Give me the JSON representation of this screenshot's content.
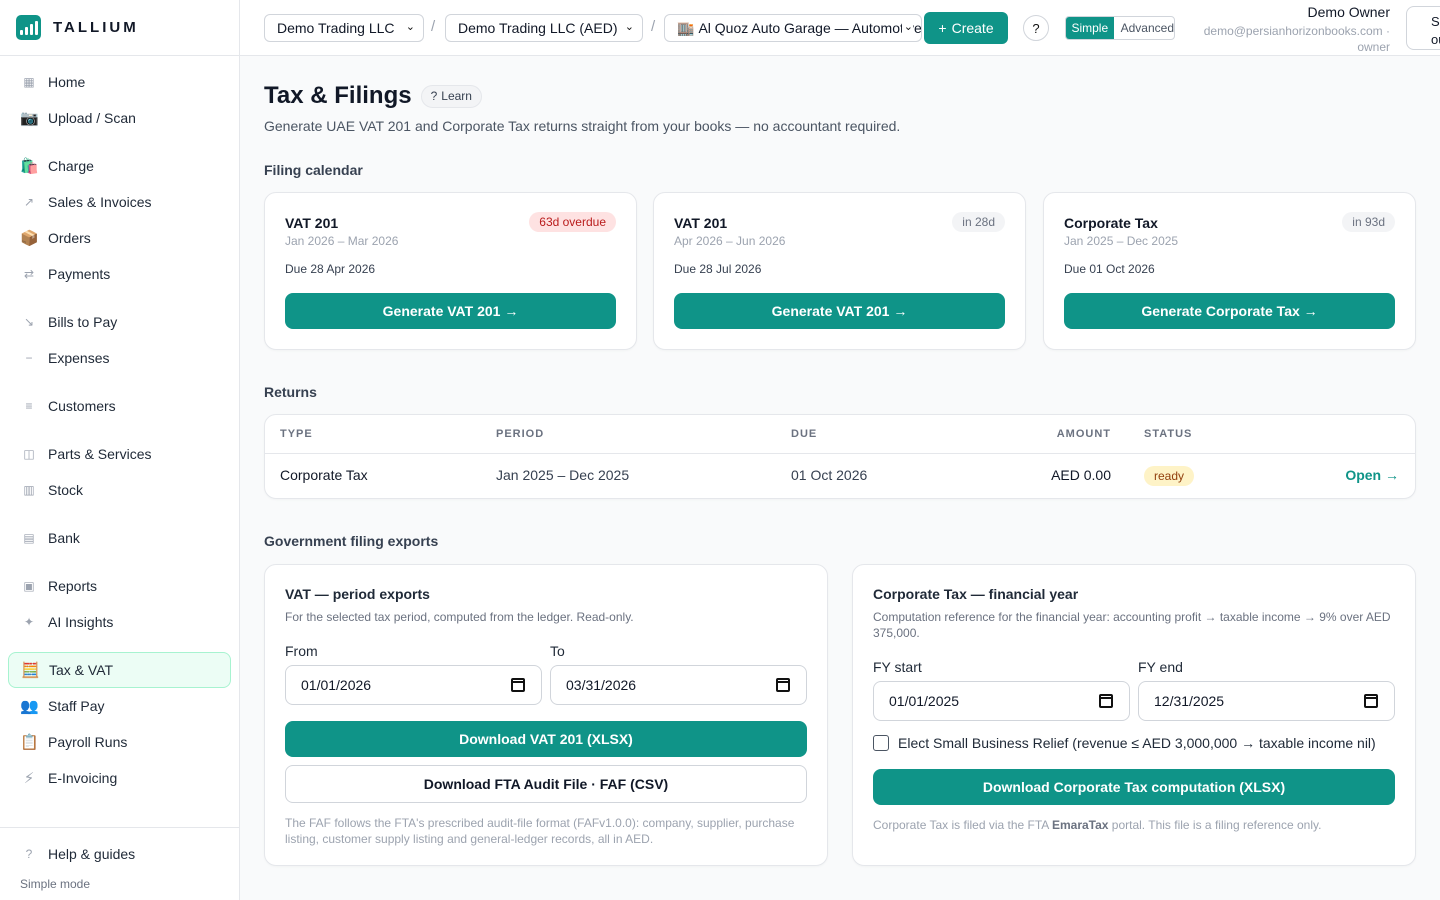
{
  "brand": {
    "name": "TALLIUM"
  },
  "sidebar": {
    "items": [
      {
        "label": "Home",
        "icon": "grid-icon",
        "glyph": "▦"
      },
      {
        "label": "Upload / Scan",
        "icon": "camera-icon",
        "glyph": "📷"
      },
      {
        "label": "Charge",
        "icon": "shopping-bags-icon",
        "glyph": "🛍️"
      },
      {
        "label": "Sales & Invoices",
        "icon": "arrow-up-right-icon",
        "glyph": "↗"
      },
      {
        "label": "Orders",
        "icon": "package-icon",
        "glyph": "📦"
      },
      {
        "label": "Payments",
        "icon": "arrows-swap-icon",
        "glyph": "⇄"
      },
      {
        "label": "Bills to Pay",
        "icon": "arrow-down-right-icon",
        "glyph": "↘"
      },
      {
        "label": "Expenses",
        "icon": "minus-icon",
        "glyph": "−"
      },
      {
        "label": "Customers",
        "icon": "list-icon",
        "glyph": "≡"
      },
      {
        "label": "Parts & Services",
        "icon": "box-icon",
        "glyph": "◫"
      },
      {
        "label": "Stock",
        "icon": "shelves-icon",
        "glyph": "▥"
      },
      {
        "label": "Bank",
        "icon": "bank-icon",
        "glyph": "▤"
      },
      {
        "label": "Reports",
        "icon": "square-icon",
        "glyph": "▣"
      },
      {
        "label": "AI Insights",
        "icon": "sparkle-icon",
        "glyph": "✦"
      },
      {
        "label": "Tax & VAT",
        "icon": "abacus-icon",
        "glyph": "🧮"
      },
      {
        "label": "Staff Pay",
        "icon": "people-icon",
        "glyph": "👥"
      },
      {
        "label": "Payroll Runs",
        "icon": "clipboard-icon",
        "glyph": "📋"
      },
      {
        "label": "E-Invoicing",
        "icon": "lightning-icon",
        "glyph": "⚡"
      }
    ],
    "active": "Tax & VAT",
    "help_label": "Help & guides",
    "mode_note": "Simple mode"
  },
  "topbar": {
    "company": "Demo Trading LLC",
    "ledger": "Demo Trading LLC (AED)",
    "branch": "Al Quoz Auto Garage — Automotive",
    "create_label": "Create",
    "help_label": "?",
    "mode_simple": "Simple",
    "mode_advanced": "Advanced",
    "user_name": "Demo Owner",
    "user_email": "demo@persianhorizonbooks.com ·",
    "user_role": "owner",
    "signout_label": "Sign out"
  },
  "page": {
    "title": "Tax & Filings",
    "learn_label": "Learn",
    "subtitle": "Generate UAE VAT 201 and Corporate Tax returns straight from your books — no accountant required."
  },
  "calendar": {
    "heading": "Filing calendar",
    "cards": [
      {
        "name": "VAT 201",
        "period": "Jan 2026 – Mar 2026",
        "due": "Due 28 Apr 2026",
        "badge": "63d overdue",
        "button": "Generate VAT 201 →"
      },
      {
        "name": "VAT 201",
        "period": "Apr 2026 – Jun 2026",
        "due": "Due 28 Jul 2026",
        "badge": "in 28d",
        "button": "Generate VAT 201 →"
      },
      {
        "name": "Corporate Tax",
        "period": "Jan 2025 – Dec 2025",
        "due": "Due 01 Oct 2026",
        "badge": "in 93d",
        "button": "Generate Corporate Tax →"
      }
    ]
  },
  "returns": {
    "heading": "Returns",
    "columns": [
      "TYPE",
      "PERIOD",
      "DUE",
      "AMOUNT",
      "STATUS"
    ],
    "rows": [
      {
        "type": "Corporate Tax",
        "period": "Jan 2025 – Dec 2025",
        "due": "01 Oct 2026",
        "amount": "AED 0.00",
        "status": "ready",
        "action": "Open →"
      }
    ]
  },
  "exports": {
    "heading": "Government filing exports",
    "vat": {
      "title": "VAT — period exports",
      "desc": "For the selected tax period, computed from the ledger. Read-only.",
      "from_label": "From",
      "from_value": "01/01/2026",
      "to_label": "To",
      "to_value": "03/31/2026",
      "download_vat": "Download VAT 201 (XLSX)",
      "download_faf": "Download FTA Audit File · FAF (CSV)",
      "footnote": "The FAF follows the FTA's prescribed audit-file format (FAFv1.0.0): company, supplier, purchase listing, customer supply listing and general-ledger records, all in AED."
    },
    "ct": {
      "title": "Corporate Tax — financial year",
      "desc": "Computation reference for the financial year: accounting profit → taxable income → 9% over AED 375,000.",
      "fy_start_label": "FY start",
      "fy_start_value": "01/01/2025",
      "fy_end_label": "FY end",
      "fy_end_value": "12/31/2025",
      "relief_label": "Elect Small Business Relief (revenue ≤ AED 3,000,000 → taxable income nil)",
      "download_ct": "Download Corporate Tax computation (XLSX)",
      "footnote_pre": "Corporate Tax is filed via the FTA ",
      "footnote_bold": "EmaraTax",
      "footnote_post": " portal. This file is a filing reference only."
    }
  },
  "colors": {
    "accent": "#0f9488",
    "overdue": "#b91c1c",
    "ready": "#92400e"
  }
}
